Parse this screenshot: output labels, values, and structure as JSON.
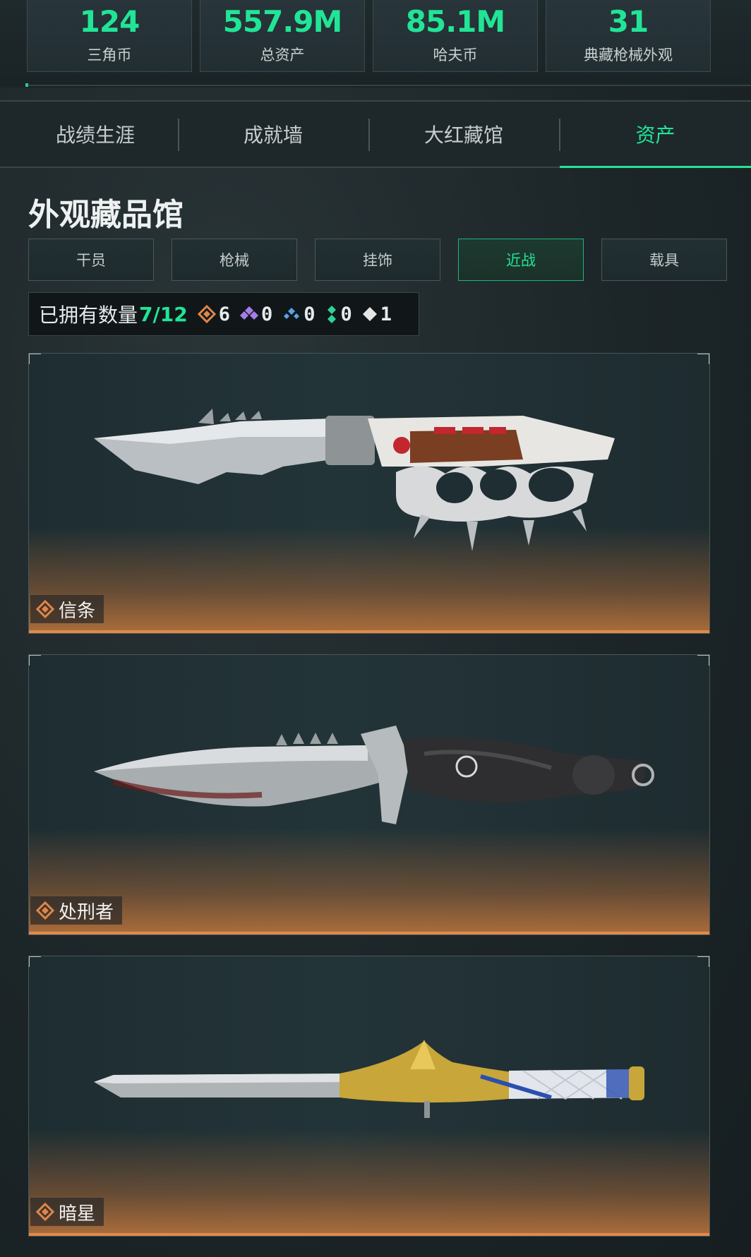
{
  "stats": [
    {
      "value": "124",
      "label": "三角币"
    },
    {
      "value": "557.9M",
      "label": "总资产"
    },
    {
      "value": "85.1M",
      "label": "哈夫币"
    },
    {
      "value": "31",
      "label": "典藏枪械外观"
    }
  ],
  "tabs": [
    {
      "label": "战绩生涯"
    },
    {
      "label": "成就墙"
    },
    {
      "label": "大红藏馆"
    },
    {
      "label": "资产",
      "active": true
    }
  ],
  "section": {
    "title": "外观藏品馆"
  },
  "filters": [
    {
      "label": "干员"
    },
    {
      "label": "枪械"
    },
    {
      "label": "挂饰"
    },
    {
      "label": "近战",
      "active": true
    },
    {
      "label": "载具"
    }
  ],
  "owned": {
    "label": "已拥有数量",
    "count": "7/12",
    "rarities": [
      {
        "icon": "orange-diamond-icon",
        "color": "#e0864a",
        "count": "6"
      },
      {
        "icon": "purple-diamond-icon",
        "color": "#a77ee8",
        "count": "0"
      },
      {
        "icon": "blue-diamond-icon",
        "color": "#5aa2e8",
        "count": "0"
      },
      {
        "icon": "green-diamond-icon",
        "color": "#2fd398",
        "count": "0"
      },
      {
        "icon": "white-diamond-icon",
        "color": "#e6e6e6",
        "count": "1"
      }
    ]
  },
  "items": [
    {
      "name": "信条",
      "rarity_icon": "orange-diamond-icon"
    },
    {
      "name": "处刑者",
      "rarity_icon": "orange-diamond-icon"
    },
    {
      "name": "暗星",
      "rarity_icon": "orange-diamond-icon"
    }
  ],
  "colors": {
    "accent": "#21e596",
    "rarity_gold": "#e0864a"
  }
}
